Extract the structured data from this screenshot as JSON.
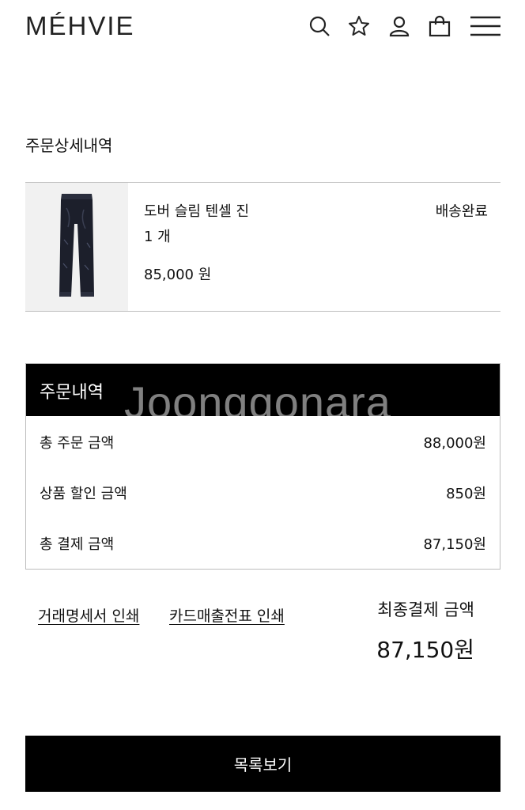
{
  "header": {
    "logo": "MÉHVIE",
    "icons": [
      "search-icon",
      "star-icon",
      "user-icon",
      "shopping-bag-icon",
      "menu-icon"
    ]
  },
  "page": {
    "title": "주문상세내역"
  },
  "order_item": {
    "name": "도버 슬림 텐셀 진",
    "quantity": "1 개",
    "price": "85,000 원",
    "status": "배송완료",
    "image_icon": "jeans-image"
  },
  "summary": {
    "title": "주문내역",
    "watermark": "Joonggonara",
    "rows": [
      {
        "label": "총 주문 금액",
        "value": "88,000원"
      },
      {
        "label": "상품 할인 금액",
        "value": "850원"
      },
      {
        "label": "총 결제 금액",
        "value": "87,150원"
      }
    ]
  },
  "links": {
    "statement_print": "거래명세서 인쇄",
    "card_receipt_print": "카드매출전표 인쇄"
  },
  "final": {
    "label": "최종결제 금액",
    "amount": "87,150원"
  },
  "buttons": {
    "list": "목록보기"
  },
  "colors": {
    "black": "#000000",
    "border": "#bdbdbd",
    "thumb_bg": "#f1f1f1"
  }
}
